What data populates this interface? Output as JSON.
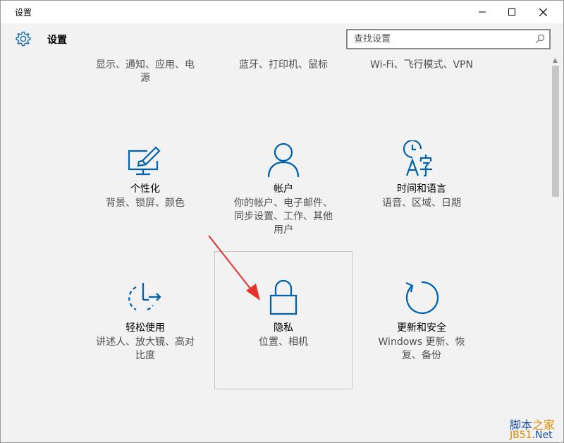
{
  "window": {
    "title": "设置"
  },
  "header": {
    "title": "设置",
    "search_placeholder": "查找设置"
  },
  "top_row": [
    {
      "desc1": "显示、通知、应用、电",
      "desc2": "源"
    },
    {
      "desc1": "蓝牙、打印机、鼠标"
    },
    {
      "desc1": "Wi-Fi、飞行模式、VPN"
    }
  ],
  "tiles": [
    {
      "name": "个性化",
      "desc1": "背景、锁屏、颜色",
      "icon": "personalization-icon"
    },
    {
      "name": "帐户",
      "desc1": "你的帐户、电子邮件、",
      "desc2": "同步设置、工作、其他",
      "desc3": "用户",
      "icon": "accounts-icon"
    },
    {
      "name": "时间和语言",
      "desc1": "语音、区域、日期",
      "icon": "time-language-icon"
    },
    {
      "name": "轻松使用",
      "desc1": "讲述人、放大镜、高对",
      "desc2": "比度",
      "icon": "ease-of-access-icon"
    },
    {
      "name": "隐私",
      "desc1": "位置、相机",
      "icon": "lock-icon"
    },
    {
      "name": "更新和安全",
      "desc1": "Windows 更新、恢",
      "desc2": "复、备份",
      "icon": "update-icon"
    }
  ],
  "colors": {
    "accent": "#0063b1",
    "arrow": "#e8322d"
  },
  "watermark": {
    "line1a": "脚本",
    "line1b": "之家",
    "line2a": "JB51",
    "line2b": ".Net"
  }
}
